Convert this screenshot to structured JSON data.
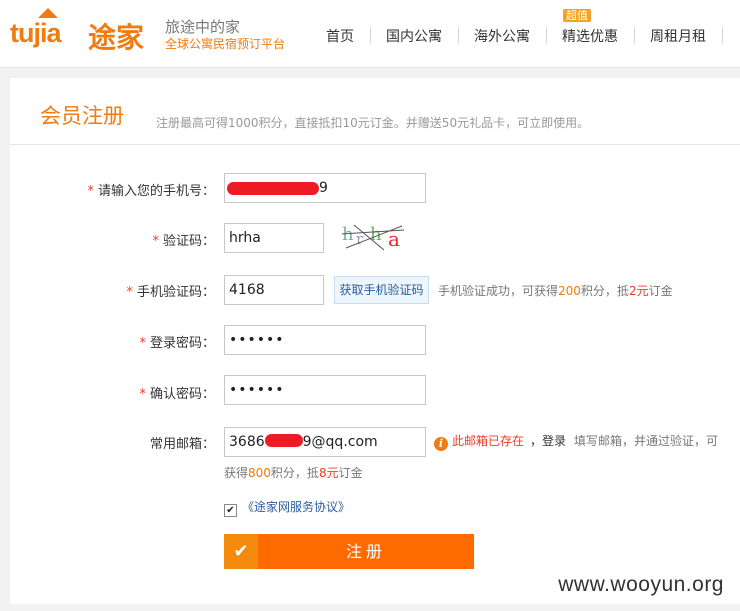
{
  "header": {
    "logo_text": "tujia",
    "logo_cn": "途家",
    "slogan_main": "旅途中的家",
    "slogan_sub": "全球公寓民宿预订平台",
    "nav": [
      {
        "label": "首页"
      },
      {
        "label": "国内公寓"
      },
      {
        "label": "海外公寓"
      },
      {
        "label": "精选优惠",
        "badge": "超值"
      },
      {
        "label": "周租月租"
      }
    ]
  },
  "page": {
    "title": "会员注册",
    "subtitle": "注册最高可得1000积分，直接抵扣10元订金。并赠送50元礼品卡，可立即使用。"
  },
  "form": {
    "required_mark": "*",
    "phone": {
      "label": "请输入您的手机号：",
      "value": "9"
    },
    "captcha": {
      "label": "验证码：",
      "value": "hrha",
      "image_text": "hrha"
    },
    "sms_code": {
      "label": "手机验证码：",
      "value": "4168",
      "button": "获取手机验证码",
      "note_prefix": "手机验证成功，可获得",
      "note_points": "200",
      "note_mid": "积分，抵",
      "note_amount": "2元",
      "note_suffix": "订金"
    },
    "password": {
      "label": "登录密码：",
      "value": "••••••"
    },
    "confirm_password": {
      "label": "确认密码：",
      "value": "••••••"
    },
    "email": {
      "label": "常用邮箱：",
      "value_start": "3686",
      "value_end": "9@qq.com",
      "warning": "此邮箱已存在",
      "login_link": "，登录",
      "hint_a": "填写邮箱，并通过验证，可",
      "hint_b_prefix": "获得",
      "hint_b_points": "800",
      "hint_b_mid": "积分，抵",
      "hint_b_amount": "8元",
      "hint_b_suffix": "订金"
    },
    "agreement": {
      "checked": true,
      "check_glyph": "✔",
      "link": "《途家网服务协议》"
    },
    "submit": {
      "check_glyph": "✔",
      "label": "注册"
    }
  },
  "watermark": "www.wooyun.org",
  "colors": {
    "brand": "#f07b10",
    "submit": "#ff6b00",
    "link": "#2a5d9e",
    "error": "#ee3c24"
  }
}
